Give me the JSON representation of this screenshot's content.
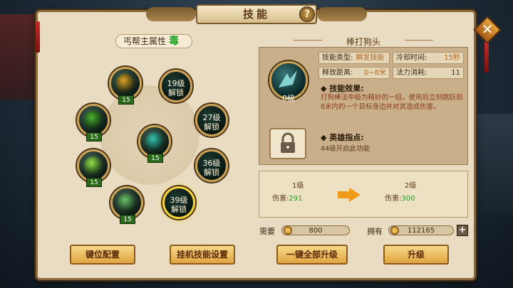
{
  "window": {
    "title": "技能",
    "help_label": "?",
    "close_label": "✕"
  },
  "left": {
    "attr_label": "丐帮主属性",
    "attr_value": "毒",
    "skills": [
      {
        "state": "learned",
        "level": "15",
        "color": "#d9a026"
      },
      {
        "state": "locked",
        "text": "19级\n解锁"
      },
      {
        "state": "learned",
        "level": "15",
        "color": "#4caf2e"
      },
      {
        "state": "learned",
        "level": "15",
        "color": "#37c4b0"
      },
      {
        "state": "locked",
        "text": "27级\n解锁"
      },
      {
        "state": "learned",
        "level": "15",
        "color": "#8fe04a"
      },
      {
        "state": "locked",
        "text": "36级\n解锁"
      },
      {
        "state": "learned",
        "level": "15",
        "color": "#6ac06a"
      },
      {
        "state": "locked",
        "text": "39级\n解锁",
        "selected": true
      }
    ]
  },
  "right": {
    "skill_name": "棒打狗头",
    "current_level": "0级",
    "stats": {
      "type_label": "技能类型:",
      "type_value": "瞬发技能",
      "cooldown_label": "冷却时间:",
      "cooldown_value": "15秒",
      "range_label": "释放距离:",
      "range_value": "0~8米",
      "cost_label": "法力消耗:",
      "cost_value": "11"
    },
    "effect_title": "技能效果:",
    "effect_desc": "打狗棒法中极为精妙的一招，使用后立刻跳跃到8米内的一个目标身边并对其造成伤害。",
    "hero_title": "英雄指点:",
    "hero_desc": "44级开启此功能",
    "compare": {
      "left_level": "1级",
      "left_dmg_label": "伤害:",
      "left_dmg_value": "291",
      "right_level": "2级",
      "right_dmg_label": "伤害:",
      "right_dmg_value": "300"
    }
  },
  "cost": {
    "need_label": "需要",
    "need_value": "800",
    "have_label": "拥有",
    "have_value": "112165",
    "plus_label": "+"
  },
  "buttons": {
    "key_config": "键位配置",
    "auto_skill": "挂机技能设置",
    "upgrade_all": "一键全部升级",
    "upgrade": "升级"
  }
}
